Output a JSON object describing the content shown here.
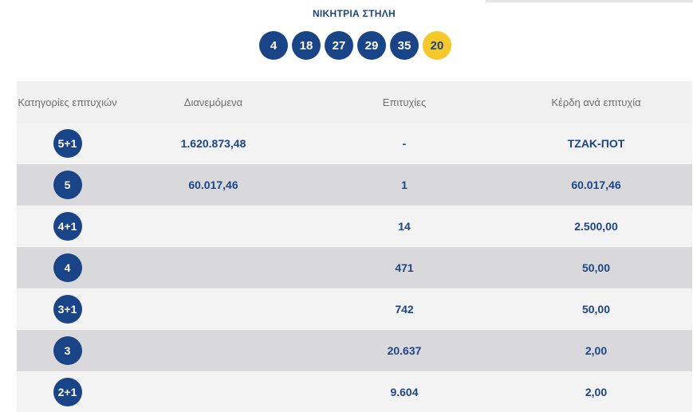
{
  "winning_column": {
    "title": "ΝΙΚΗΤΡΙΑ ΣΤΗΛΗ",
    "numbers": [
      "4",
      "18",
      "27",
      "29",
      "35"
    ],
    "bonus": "20"
  },
  "table": {
    "headers": {
      "categories": "Κατηγορίες επιτυχιών",
      "distributed": "Διανεμόμενα",
      "winners": "Επιτυχίες",
      "prize_per_winner": "Κέρδη ανά επιτυχία"
    },
    "rows": [
      {
        "category": "5+1",
        "distributed": "1.620.873,48",
        "winners": "-",
        "prize": "ΤΖΑΚ-ΠΟΤ"
      },
      {
        "category": "5",
        "distributed": "60.017,46",
        "winners": "1",
        "prize": "60.017,46"
      },
      {
        "category": "4+1",
        "distributed": "",
        "winners": "14",
        "prize": "2.500,00"
      },
      {
        "category": "4",
        "distributed": "",
        "winners": "471",
        "prize": "50,00"
      },
      {
        "category": "3+1",
        "distributed": "",
        "winners": "742",
        "prize": "50,00"
      },
      {
        "category": "3",
        "distributed": "",
        "winners": "20.637",
        "prize": "2,00"
      },
      {
        "category": "2+1",
        "distributed": "",
        "winners": "9.604",
        "prize": "2,00"
      }
    ]
  },
  "colors": {
    "primary_blue": "#1a4488",
    "bonus_yellow": "#f7c829",
    "row_light": "#f3f3f3",
    "row_dark": "#d9d9db"
  }
}
